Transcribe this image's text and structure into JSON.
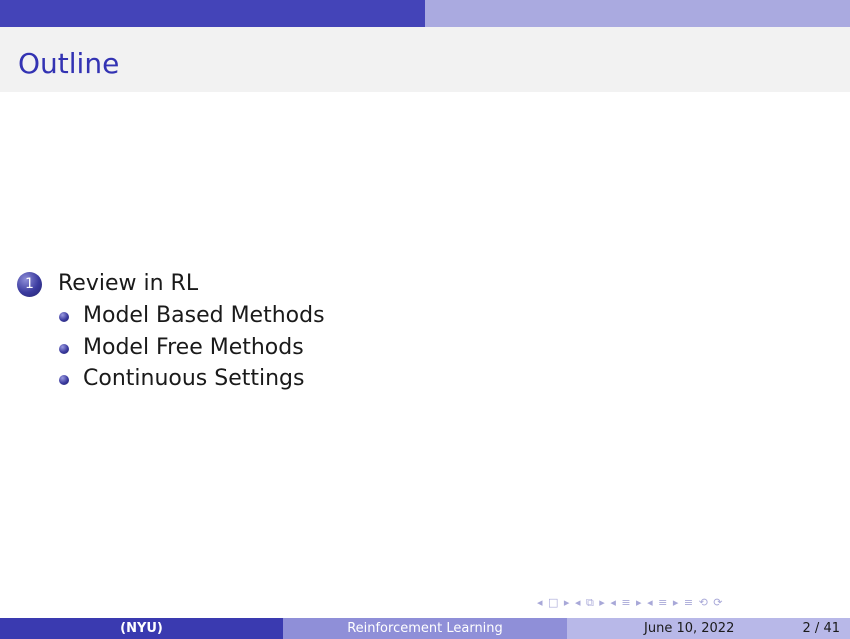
{
  "header": {
    "title": "Outline",
    "colors": {
      "top_left": "#4444b8",
      "top_right": "#aaaae0",
      "title_text": "#3333b3",
      "title_bg": "#f2f2f2"
    }
  },
  "outline": {
    "section_number": "1",
    "section_label": "Review in RL",
    "items": [
      {
        "label": "Model Based Methods"
      },
      {
        "label": "Model Free Methods"
      },
      {
        "label": "Continuous Settings"
      }
    ]
  },
  "nav": {
    "symbols": [
      "◂ □ ▸",
      "◂ ⧉ ▸",
      "◂ ≡ ▸",
      "◂ ≡ ▸",
      "≡",
      "⟲ ⟳"
    ],
    "icons": [
      "frame-nav-icon",
      "slide-nav-icon",
      "section-nav-icon",
      "subsection-nav-icon",
      "appendix-icon",
      "search-back-icon"
    ]
  },
  "footer": {
    "author": "(NYU)",
    "course": "Reinforcement Learning",
    "date": "June 10, 2022",
    "page": "2 / 41",
    "colors": {
      "left": "#3a3ab0",
      "middle": "#8f8fd8",
      "right": "#b8b8e8"
    }
  }
}
